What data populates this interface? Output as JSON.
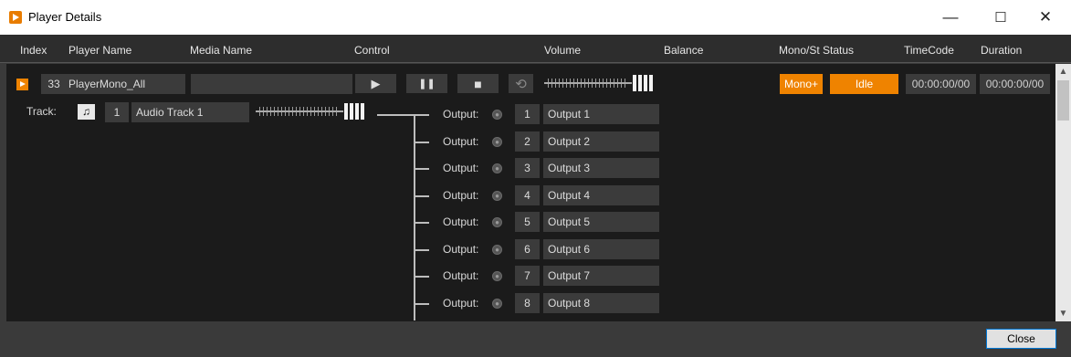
{
  "window": {
    "title": "Player Details",
    "min": "—",
    "max": "☐",
    "close": "✕"
  },
  "header": [
    "Index",
    "Player Name",
    "Media Name",
    "Control",
    "Volume",
    "Balance",
    "Mono/St Status",
    "TimeCode",
    "Duration"
  ],
  "player": {
    "index": "33",
    "name": "PlayerMono_All",
    "media": "",
    "mode": "Mono+",
    "status": "Idle",
    "timecode": "00:00:00/00",
    "duration": "00:00:00/00"
  },
  "controls": {
    "play": "▶",
    "pause": "❚❚",
    "stop": "■",
    "loop": "⟲"
  },
  "track": {
    "label": "Track:",
    "icon": "♫",
    "number": "1",
    "name": "Audio Track 1"
  },
  "outputs": [
    {
      "label": "Output:",
      "number": "1",
      "name": "Output 1"
    },
    {
      "label": "Output:",
      "number": "2",
      "name": "Output 2"
    },
    {
      "label": "Output:",
      "number": "3",
      "name": "Output 3"
    },
    {
      "label": "Output:",
      "number": "4",
      "name": "Output 4"
    },
    {
      "label": "Output:",
      "number": "5",
      "name": "Output 5"
    },
    {
      "label": "Output:",
      "number": "6",
      "name": "Output 6"
    },
    {
      "label": "Output:",
      "number": "7",
      "name": "Output 7"
    },
    {
      "label": "Output:",
      "number": "8",
      "name": "Output 8"
    }
  ],
  "footer": {
    "close_label": "Close"
  },
  "colors": {
    "accent": "#ef8300",
    "panel": "#1b1b1b",
    "field": "#3b3b3b"
  }
}
